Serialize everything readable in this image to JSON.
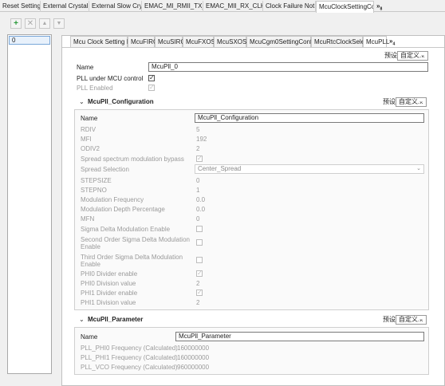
{
  "top_tabs": [
    "Reset Setting",
    "External Crystal ...",
    "External Slow Cry...",
    "EMAC_MI_RMII_TX_C...",
    "EMAC_MII_RX_CLK E...",
    "Clock Failure Not...",
    "McuClockSettingCo..."
  ],
  "top_overflow": "»",
  "top_overflow_count": "8",
  "toolbar": {
    "add": "+",
    "remove": "✕",
    "up": "▲",
    "down": "▼"
  },
  "list": {
    "items": [
      "0"
    ]
  },
  "sub_tabs": [
    "Mcu Clock Setting Id",
    "McuFIRC",
    "McuSIRC",
    "McuFXOSC",
    "McuSXOSC",
    "McuCgm0SettingConfig",
    "McuRtcClockSelect",
    "McuPLL"
  ],
  "sub_overflow": "»",
  "sub_overflow_count": "4",
  "preset_label": "预设",
  "preset_value": "自定义...",
  "main": {
    "name_label": "Name",
    "name_value": "McuPll_0",
    "pll_under_mcu_label": "PLL under MCU control",
    "pll_enabled_label": "PLL Enabled"
  },
  "configuration": {
    "title": "McuPll_Configuration",
    "name_label": "Name",
    "name_value": "McuPll_Configuration",
    "rows": [
      {
        "label": "RDIV",
        "value": "5"
      },
      {
        "label": "MFI",
        "value": "192"
      },
      {
        "label": "ODIV2",
        "value": "2"
      },
      {
        "label": "Spread spectrum modulation bypass",
        "value": ""
      },
      {
        "label": "Spread Selection",
        "value": "Center_Spread"
      },
      {
        "label": "STEPSIZE",
        "value": "0"
      },
      {
        "label": "STEPNO",
        "value": "1"
      },
      {
        "label": "Modulation Frequency",
        "value": "0.0"
      },
      {
        "label": "Modulation Depth Percentage",
        "value": "0.0"
      },
      {
        "label": "MFN",
        "value": "0"
      },
      {
        "label": "Sigma Delta Modulation Enable",
        "value": ""
      },
      {
        "label": "Second Order Sigma Delta Modulation",
        "label2": "Enable",
        "value": ""
      },
      {
        "label": "Third Order Sigma Delta Modulation",
        "label2": "Enable",
        "value": ""
      },
      {
        "label": "PHI0 Divider enable",
        "value": ""
      },
      {
        "label": "PHI0 Division value",
        "value": "2"
      },
      {
        "label": "PHI1 Divider enable",
        "value": ""
      },
      {
        "label": "PHI1 Division value",
        "value": "2"
      }
    ]
  },
  "parameter": {
    "title": "McuPll_Parameter",
    "name_label": "Name",
    "name_value": "McuPll_Parameter",
    "rows": [
      {
        "label": "PLL_PHI0 Frequency (Calculated)",
        "value": "160000000"
      },
      {
        "label": "PLL_PHI1 Frequency (Calculated)",
        "value": "160000000"
      },
      {
        "label": "PLL_VCO Frequency (Calculated)",
        "value": "960000000"
      }
    ]
  }
}
